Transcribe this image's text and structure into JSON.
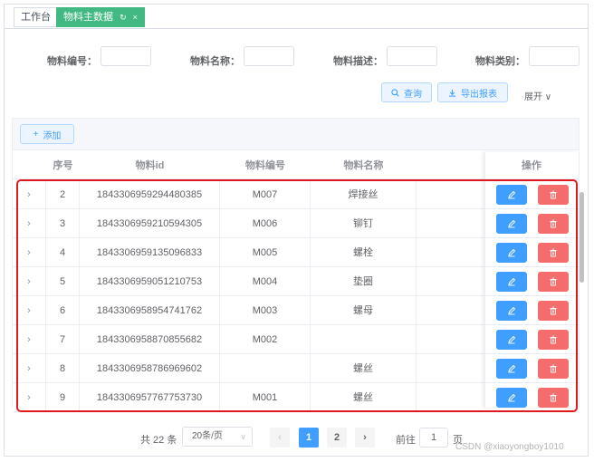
{
  "tabs": [
    {
      "label": "工作台"
    },
    {
      "label": "物料主数据",
      "refresh": "↻",
      "close": "×"
    }
  ],
  "search": {
    "fields": [
      {
        "label": "物料编号：",
        "value": ""
      },
      {
        "label": "物料名称：",
        "value": ""
      },
      {
        "label": "物料描述：",
        "value": ""
      },
      {
        "label": "物料类别：",
        "value": ""
      }
    ],
    "query_label": "查询",
    "export_label": "导出报表",
    "expand_label": "展开",
    "expand_icon": "∨"
  },
  "toolbar": {
    "add_icon": "+",
    "add_label": "添加"
  },
  "table": {
    "columns": [
      "序号",
      "物料id",
      "物料编号",
      "物料名称",
      "操作"
    ],
    "rows": [
      {
        "idx": "2",
        "id": "1843306959294480385",
        "code": "M007",
        "name": "焊接丝"
      },
      {
        "idx": "3",
        "id": "1843306959210594305",
        "code": "M006",
        "name": "铆钉"
      },
      {
        "idx": "4",
        "id": "1843306959135096833",
        "code": "M005",
        "name": "螺栓"
      },
      {
        "idx": "5",
        "id": "1843306959051210753",
        "code": "M004",
        "name": "垫圈"
      },
      {
        "idx": "6",
        "id": "1843306958954741762",
        "code": "M003",
        "name": "螺母"
      },
      {
        "idx": "7",
        "id": "1843306958870855682",
        "code": "M002",
        "name": ""
      },
      {
        "idx": "8",
        "id": "1843306958786969602",
        "code": "",
        "name": "螺丝"
      },
      {
        "idx": "9",
        "id": "1843306957767753730",
        "code": "M001",
        "name": "螺丝"
      }
    ],
    "expand_icon": "›"
  },
  "pagination": {
    "total_text": "共 22 条",
    "page_size": "20条/页",
    "prev": "‹",
    "pages": [
      "1",
      "2"
    ],
    "next": "›",
    "goto_label": "前往",
    "goto_value": "1",
    "page_unit": "页"
  },
  "watermark": "CSDN @xiaoyongboy1010",
  "colors": {
    "primary": "#409eff",
    "danger": "#f56c6c",
    "tab_active": "#42b983",
    "highlight": "#e0191e"
  }
}
